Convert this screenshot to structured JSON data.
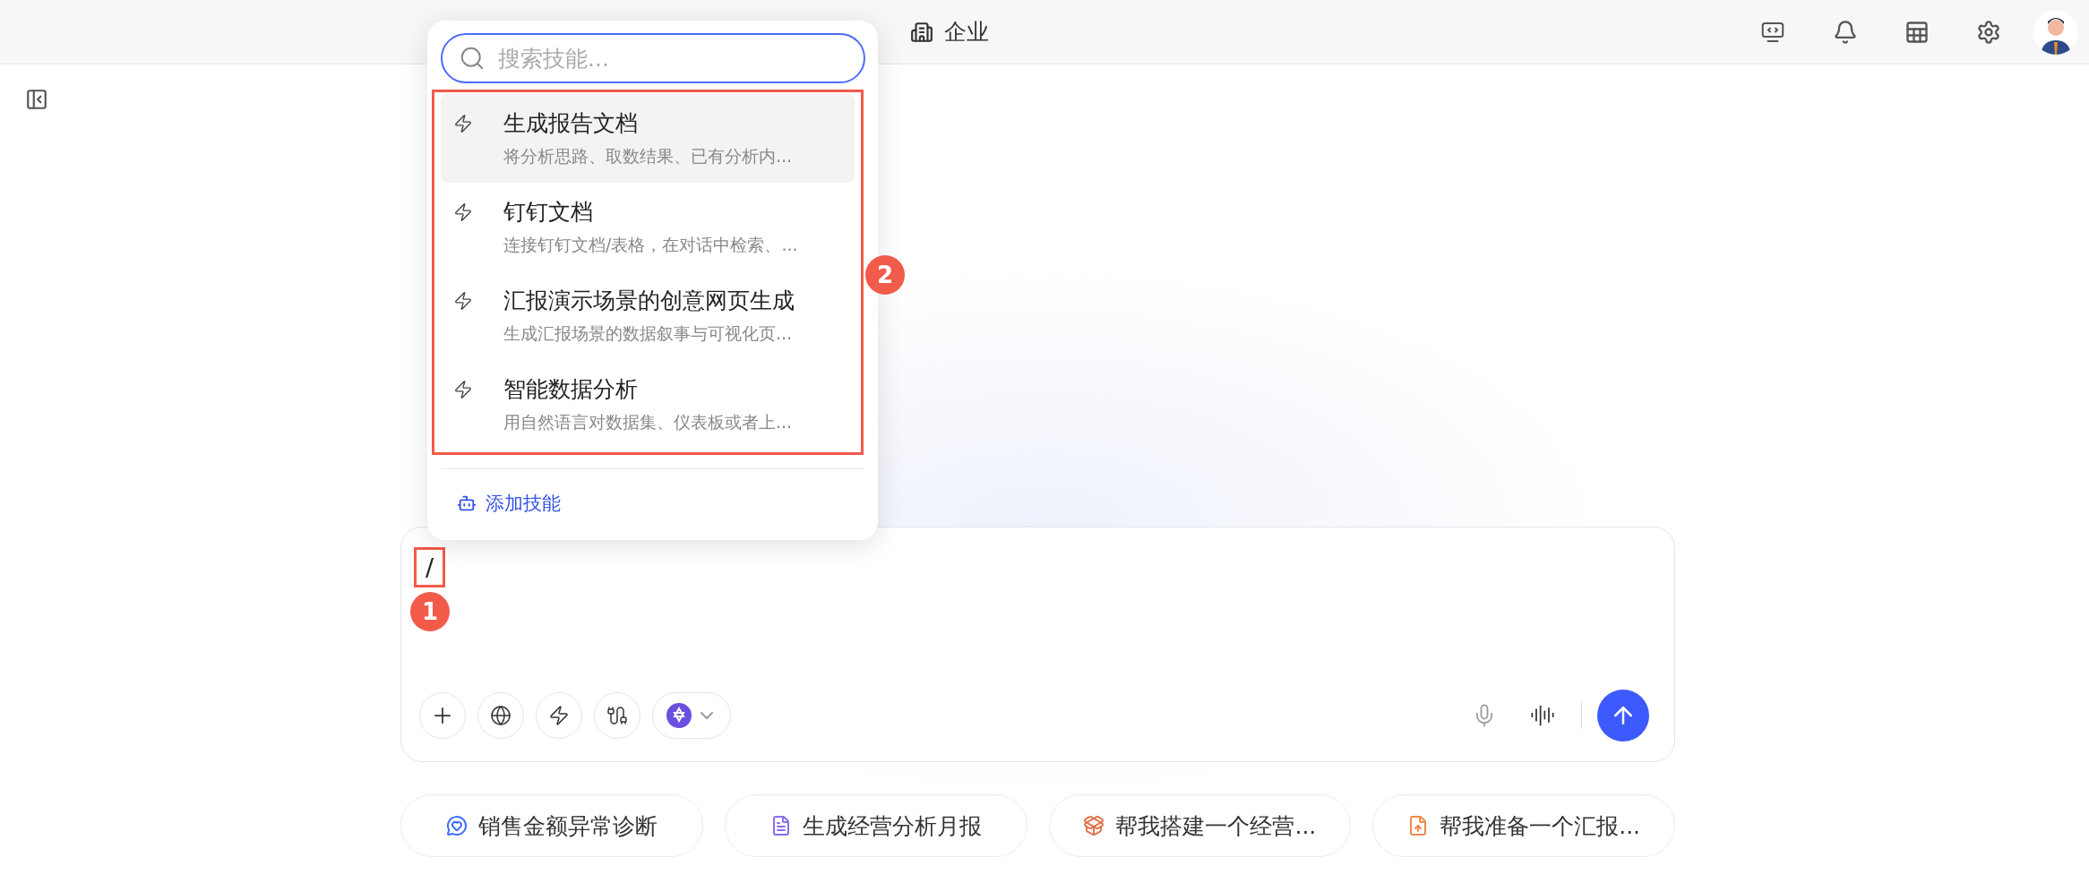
{
  "top_nav": {
    "items": [
      {
        "label": "企业"
      }
    ]
  },
  "skills_popup": {
    "search": {
      "placeholder": "搜索技能..."
    },
    "skills": [
      {
        "title": "生成报告文档",
        "description": "将分析思路、取数结果、已有分析内...",
        "selected": true
      },
      {
        "title": "钉钉文档",
        "description": "连接钉钉文档/表格，在对话中检索、...",
        "selected": false
      },
      {
        "title": "汇报演示场景的创意网页生成",
        "description": "生成汇报场景的数据叙事与可视化页...",
        "selected": false
      },
      {
        "title": "智能数据分析",
        "description": "用自然语言对数据集、仪表板或者上...",
        "selected": false
      }
    ],
    "add_skill": "添加技能",
    "annotation": "2"
  },
  "composer": {
    "value": "/",
    "annotation": "1"
  },
  "suggestions": [
    {
      "label": "销售金额异常诊断",
      "kind": "diagnose"
    },
    {
      "label": "生成经营分析月报",
      "kind": "report"
    },
    {
      "label": "帮我搭建一个经营...",
      "kind": "build"
    },
    {
      "label": "帮我准备一个汇报...",
      "kind": "upload"
    }
  ]
}
